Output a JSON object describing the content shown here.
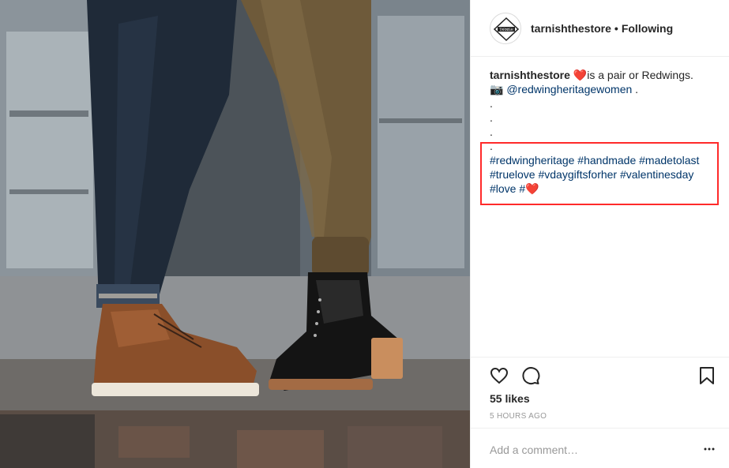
{
  "post": {
    "username": "tarnishthestore",
    "separator": "•",
    "follow_status": "Following",
    "avatar_text": "TARNISH"
  },
  "caption": {
    "username": "tarnishthestore",
    "heart": "❤️",
    "text": "is a pair or Redwings.",
    "camera": "📷",
    "mention": "@redwingheritagewomen",
    "mention_suffix": " .",
    "dots": [
      ".",
      ".",
      ".",
      "."
    ],
    "hashtags_line1": "#redwingheritage #handmade #madetolast",
    "hashtags_line2": "#truelove #vdaygiftsforher #valentinesday",
    "hashtags_line3": "#love #",
    "hashtag_heart": "❤️"
  },
  "engagement": {
    "likes": "55 likes",
    "timestamp": "5 HOURS AGO"
  },
  "comment": {
    "placeholder": "Add a comment…"
  },
  "icons": {
    "like": "heart-outline-icon",
    "comment": "speech-bubble-icon",
    "save": "bookmark-icon",
    "more": "ellipsis-icon"
  },
  "colors": {
    "link": "#003569",
    "highlight_border": "#ff2a2a",
    "muted": "#999999",
    "heart": "#ed1c24"
  }
}
